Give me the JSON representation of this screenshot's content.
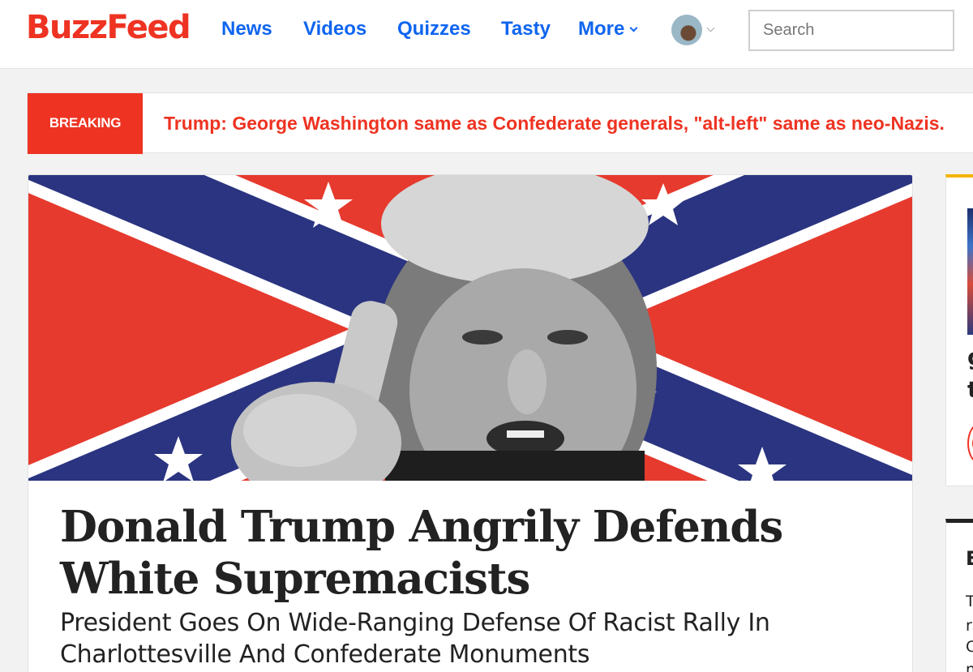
{
  "header": {
    "logo": "BuzzFeed",
    "nav": [
      {
        "label": "News"
      },
      {
        "label": "Videos"
      },
      {
        "label": "Quizzes"
      },
      {
        "label": "Tasty"
      },
      {
        "label": "More"
      }
    ],
    "search_placeholder": "Search"
  },
  "breaking": {
    "badge": "BREAKING",
    "text": "Trump: George Washington same as Confederate generals, \"alt-left\" same as neo-Nazis."
  },
  "article": {
    "headline": "Donald Trump Angrily Defends White Supremacists",
    "dek": "President Goes On Wide-Ranging Defense Of Racist Rally In Charlottesville And Confederate Monuments"
  },
  "rail": {
    "chars_1": [
      "g",
      "t"
    ],
    "chars_2": [
      "E",
      "T",
      "r",
      "C",
      "n"
    ]
  },
  "colors": {
    "brand_red": "#ee3322",
    "nav_blue": "#0f65ef",
    "rail_accent": "#f4b400"
  }
}
